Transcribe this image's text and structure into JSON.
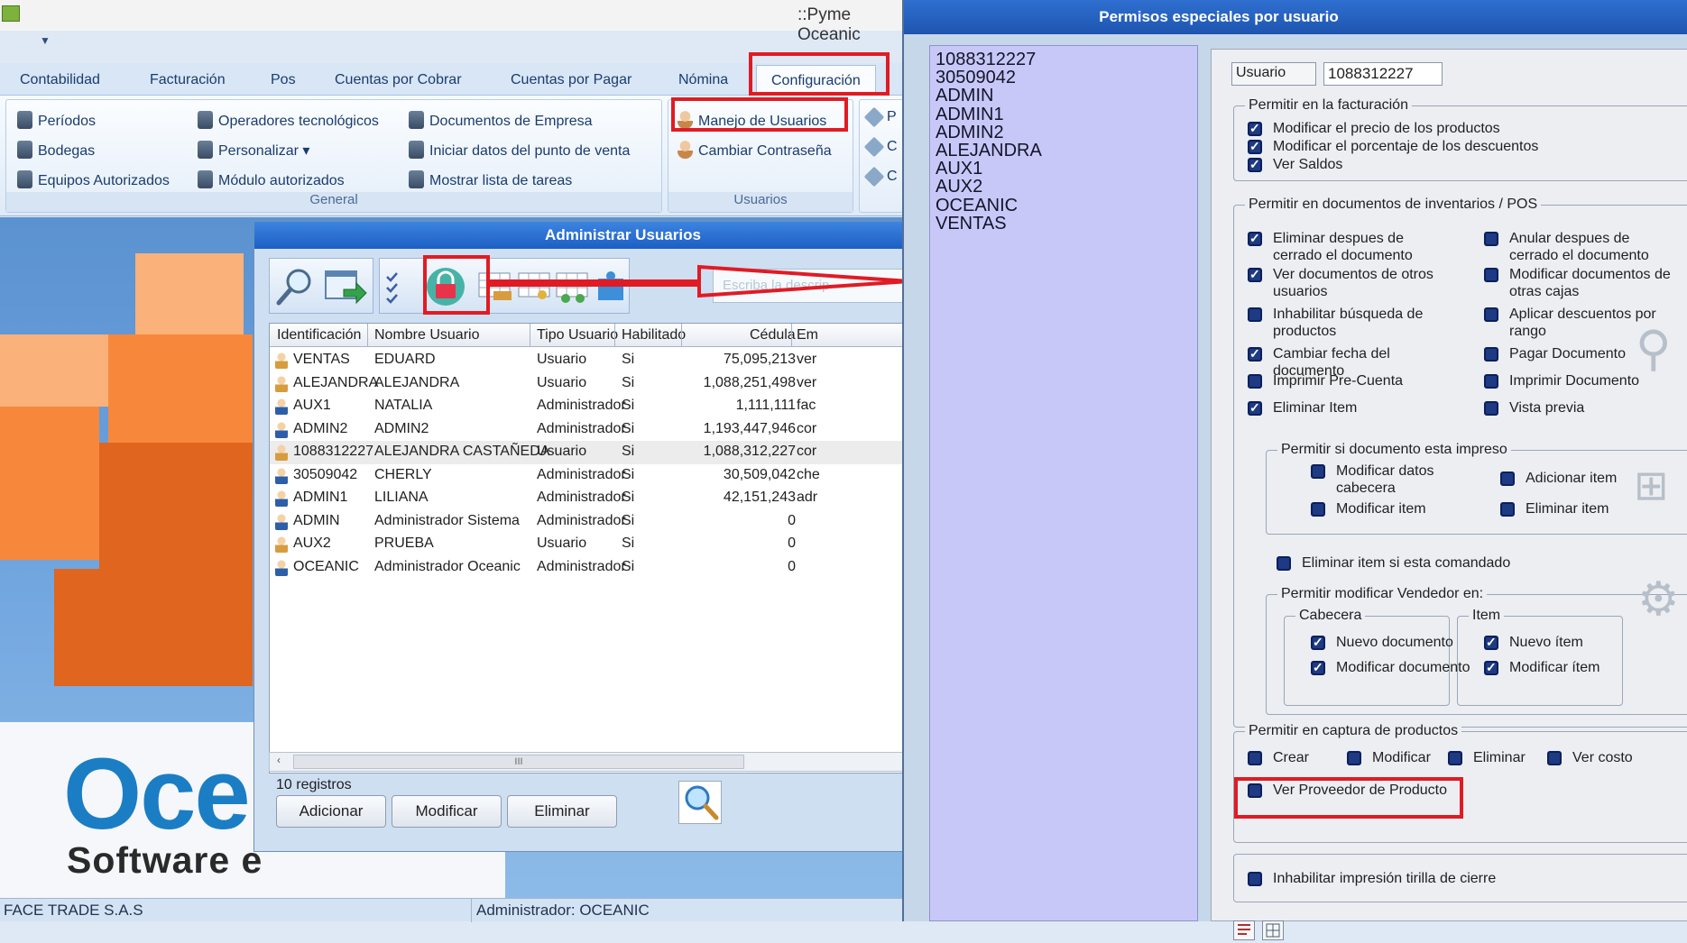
{
  "app": {
    "title": "::Pyme Oceanic",
    "tabs": [
      "Contabilidad",
      "Facturación",
      "Pos",
      "Cuentas por Cobrar",
      "Cuentas por Pagar",
      "Nómina",
      "Configuración"
    ],
    "ribbon": {
      "general_items": [
        "Períodos",
        "Bodegas",
        "Equipos Autorizados",
        "Operadores tecnológicos",
        "Personalizar ▾",
        "Módulo autorizados",
        "Documentos de Empresa",
        "Iniciar datos del punto de venta",
        "Mostrar lista de tareas"
      ],
      "general_label": "General",
      "usuarios_items": [
        "Manejo de Usuarios",
        "Cambiar Contraseña"
      ],
      "usuarios_label": "Usuarios",
      "more_items": [
        "P",
        "C",
        "C"
      ]
    },
    "brand": {
      "name": "Oce",
      "tagline": "Software e"
    },
    "status": {
      "company": "FACE TRADE S.A.S",
      "user": "Administrador: OCEANIC"
    }
  },
  "admin_window": {
    "title": "Administrar Usuarios",
    "search_placeholder": "Escriba la descrip",
    "columns": [
      "Identificación",
      "Nombre Usuario",
      "Tipo Usuario",
      "Habilitado",
      "Cédula",
      "Em"
    ],
    "rows": [
      {
        "id": "VENTAS",
        "name": "EDUARD",
        "type": "Usuario",
        "enabled": "Si",
        "cedula": "75,095,213",
        "email": "ver"
      },
      {
        "id": "ALEJANDRA",
        "name": "ALEJANDRA",
        "type": "Usuario",
        "enabled": "Si",
        "cedula": "1,088,251,498",
        "email": "ver"
      },
      {
        "id": "AUX1",
        "name": "NATALIA",
        "type": "Administrador",
        "enabled": "Si",
        "cedula": "1,111,111",
        "email": "fac"
      },
      {
        "id": "ADMIN2",
        "name": "ADMIN2",
        "type": "Administrador",
        "enabled": "Si",
        "cedula": "1,193,447,946",
        "email": "cor"
      },
      {
        "id": "1088312227",
        "name": "ALEJANDRA CASTAÑEDA",
        "type": "Usuario",
        "enabled": "Si",
        "cedula": "1,088,312,227",
        "email": "cor"
      },
      {
        "id": "30509042",
        "name": "CHERLY",
        "type": "Administrador",
        "enabled": "Si",
        "cedula": "30,509,042",
        "email": "che"
      },
      {
        "id": "ADMIN1",
        "name": "LILIANA",
        "type": "Administrador",
        "enabled": "Si",
        "cedula": "42,151,243",
        "email": "adr"
      },
      {
        "id": "ADMIN",
        "name": "Administrador Sistema",
        "type": "Administrador",
        "enabled": "Si",
        "cedula": "0",
        "email": ""
      },
      {
        "id": "AUX2",
        "name": "PRUEBA",
        "type": "Usuario",
        "enabled": "Si",
        "cedula": "0",
        "email": ""
      },
      {
        "id": "OCEANIC",
        "name": "Administrador Oceanic",
        "type": "Administrador",
        "enabled": "Si",
        "cedula": "0",
        "email": ""
      }
    ],
    "record_count": "10 registros",
    "buttons": {
      "add": "Adicionar",
      "edit": "Modificar",
      "delete": "Eliminar"
    },
    "scroll_glyph": "III"
  },
  "perm_window": {
    "title": "Permisos especiales por usuario",
    "users": [
      "1088312227",
      "30509042",
      "ADMIN",
      "ADMIN1",
      "ADMIN2",
      "ALEJANDRA",
      "AUX1",
      "AUX2",
      "OCEANIC",
      "VENTAS"
    ],
    "usuario_label": "Usuario",
    "usuario_value": "1088312227",
    "facturacion": {
      "legend": "Permitir en la facturación",
      "items": [
        {
          "label": "Modificar el precio de los productos",
          "checked": true
        },
        {
          "label": "Modificar el porcentaje de los descuentos",
          "checked": true
        },
        {
          "label": "Ver Saldos",
          "checked": true
        }
      ]
    },
    "inventarios": {
      "legend": "Permitir en documentos de inventarios / POS",
      "left": [
        {
          "label": "Eliminar despues de cerrado el documento",
          "checked": true
        },
        {
          "label": "Ver documentos de otros usuarios",
          "checked": true
        },
        {
          "label": "Inhabilitar búsqueda de productos",
          "checked": false
        },
        {
          "label": "Cambiar fecha del documento",
          "checked": true
        },
        {
          "label": "Imprimir Pre-Cuenta",
          "checked": false
        },
        {
          "label": "Eliminar Item",
          "checked": true
        }
      ],
      "right": [
        {
          "label": "Anular despues de cerrado el documento",
          "checked": false
        },
        {
          "label": "Modificar documentos de otras cajas",
          "checked": false
        },
        {
          "label": "Aplicar descuentos por rango",
          "checked": false
        },
        {
          "label": "Pagar Documento",
          "checked": false
        },
        {
          "label": "Imprimir Documento",
          "checked": false
        },
        {
          "label": "Vista previa",
          "checked": false
        }
      ],
      "impreso": {
        "legend": "Permitir si documento esta impreso",
        "items": [
          {
            "label": "Modificar datos cabecera",
            "checked": false
          },
          {
            "label": "Adicionar item",
            "checked": false
          },
          {
            "label": "Modificar item",
            "checked": false
          },
          {
            "label": "Eliminar item",
            "checked": false
          }
        ]
      },
      "comandado": {
        "label": "Eliminar item si esta comandado",
        "checked": false
      },
      "vendedor": {
        "legend": "Permitir modificar Vendedor en:",
        "cabecera": {
          "legend": "Cabecera",
          "items": [
            {
              "label": "Nuevo documento",
              "checked": true
            },
            {
              "label": "Modificar documento",
              "checked": true
            }
          ]
        },
        "item": {
          "legend": "Item",
          "items": [
            {
              "label": "Nuevo ítem",
              "checked": true
            },
            {
              "label": "Modificar ítem",
              "checked": true
            }
          ]
        }
      }
    },
    "captura": {
      "legend": "Permitir en captura de productos",
      "items": [
        {
          "label": "Crear",
          "checked": false
        },
        {
          "label": "Modificar",
          "checked": false
        },
        {
          "label": "Eliminar",
          "checked": false
        },
        {
          "label": "Ver costo",
          "checked": false
        },
        {
          "label": "Ver Proveedor de Producto",
          "checked": false
        }
      ]
    },
    "tirilla": {
      "label": "Inhabilitar impresión tirilla de cierre",
      "checked": false
    }
  },
  "colors": {
    "highlight_red": "#e01b24",
    "title_blue": "#1e55b0",
    "checkbox_navy": "#1e3a82"
  }
}
